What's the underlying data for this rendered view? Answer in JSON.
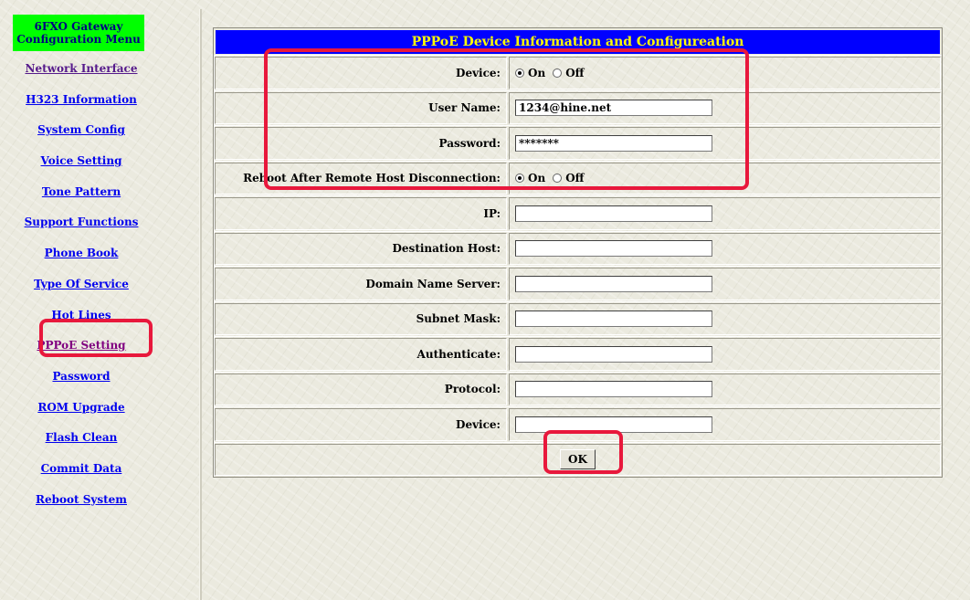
{
  "sidebar": {
    "header_line1": "6FXO Gateway",
    "header_line2": "Configuration Menu",
    "items": [
      {
        "label": "Network Interface"
      },
      {
        "label": "H323 Information"
      },
      {
        "label": "System Config"
      },
      {
        "label": "Voice Setting"
      },
      {
        "label": "Tone Pattern"
      },
      {
        "label": "Support Functions"
      },
      {
        "label": "Phone Book"
      },
      {
        "label": "Type Of Service"
      },
      {
        "label": "Hot Lines"
      },
      {
        "label": "PPPoE Setting"
      },
      {
        "label": "Password"
      },
      {
        "label": "ROM Upgrade"
      },
      {
        "label": "Flash Clean"
      },
      {
        "label": "Commit Data"
      },
      {
        "label": "Reboot System"
      }
    ]
  },
  "form": {
    "title": "PPPoE Device Information and Configureation",
    "device": {
      "label": "Device:",
      "on_label": "On",
      "off_label": "Off",
      "selected": "On"
    },
    "username": {
      "label": "User Name:",
      "value": "1234@hine.net"
    },
    "password": {
      "label": "Password:",
      "value": "*******"
    },
    "reboot": {
      "label": "Reboot After Remote Host Disconnection:",
      "on_label": "On",
      "off_label": "Off",
      "selected": "On"
    },
    "ip": {
      "label": "IP:",
      "value": ""
    },
    "destination_host": {
      "label": "Destination Host:",
      "value": ""
    },
    "dns": {
      "label": "Domain Name Server:",
      "value": ""
    },
    "subnet_mask": {
      "label": "Subnet Mask:",
      "value": ""
    },
    "authenticate": {
      "label": "Authenticate:",
      "value": ""
    },
    "protocol": {
      "label": "Protocol:",
      "value": ""
    },
    "device_name": {
      "label": "Device:",
      "value": ""
    },
    "ok_label": "OK"
  },
  "colors": {
    "header_bg": "#0000ff",
    "header_text": "#ffff00",
    "menu_header_bg": "#00ff00",
    "highlight": "#e8183c"
  }
}
